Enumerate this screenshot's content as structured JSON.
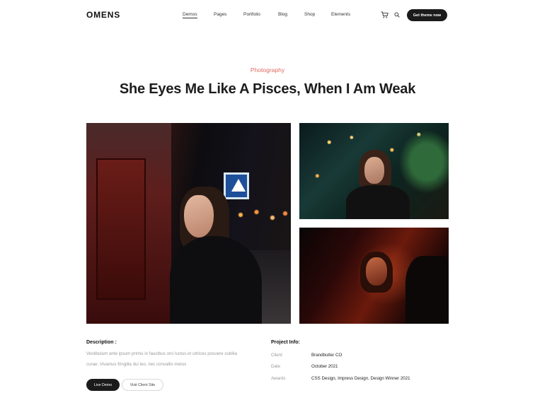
{
  "header": {
    "logo": "OMENS",
    "nav": [
      "Demos",
      "Pages",
      "Portfolio",
      "Blog",
      "Shop",
      "Elements"
    ],
    "active_nav": "Demos",
    "cta_label": "Get theme now",
    "icons": [
      "cart-icon",
      "search-icon"
    ]
  },
  "hero": {
    "category": "Photography",
    "title": "She Eyes Me Like A Pisces, When I Am Weak"
  },
  "description": {
    "heading": "Description :",
    "text": "Vestibulum ante ipsum primis in faucibus orci luctus et ultrices posuere cubilia curae; Vivamus fringilla dui leo, nec convallis metus",
    "live_demo_label": "Live Demo",
    "visit_site_label": "Visit Client Site"
  },
  "project_info": {
    "heading": "Project Info:",
    "rows": [
      {
        "key": "Client",
        "value": "Brandbutter CO"
      },
      {
        "key": "Date",
        "value": "October 2021"
      },
      {
        "key": "Awards",
        "value": "CSS Design, Impress Design, Design Winner 2021"
      }
    ]
  },
  "colors": {
    "accent": "#e06b5f",
    "dark": "#1b1b1b"
  }
}
